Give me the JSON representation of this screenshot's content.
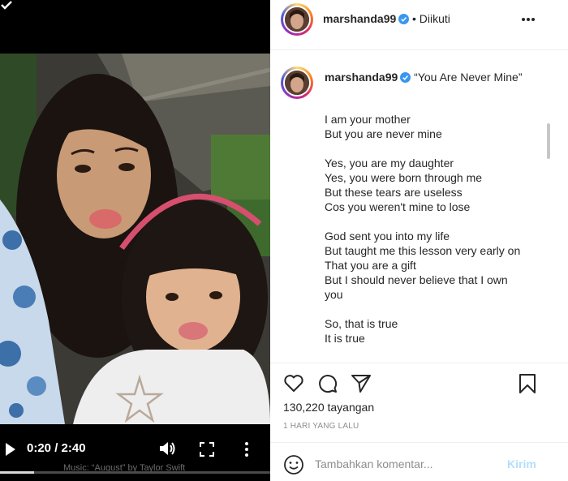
{
  "video": {
    "current_time": "0:20",
    "duration": "2:40",
    "time_separator": " / ",
    "progress_fraction": 0.125,
    "music_credit": "Music: “August” by Taylor Swift",
    "icons": [
      "back-chevron-icon",
      "play-icon",
      "volume-icon",
      "fullscreen-icon",
      "more-vertical-icon"
    ]
  },
  "post": {
    "username": "marshanda99",
    "follow_separator": "•",
    "follow_state": "Diikuti",
    "caption_title": "“You Are Never Mine”",
    "lyrics": [
      [
        "I am your mother",
        "But you are never mine"
      ],
      [
        "Yes, you are my daughter",
        "Yes, you were born through me",
        "But these tears are useless",
        "Cos you weren't mine to lose"
      ],
      [
        "God sent you into my life",
        "But taught me this lesson very early on",
        "That you are a gift",
        "But I should never believe that I own you"
      ],
      [
        "So, that is true",
        "It is true"
      ]
    ],
    "views": "130,220 tayangan",
    "date": "1 HARI YANG LALU"
  },
  "comment": {
    "placeholder": "Tambahkan komentar...",
    "send_label": "Kirim"
  },
  "colors": {
    "verified": "#3897f0",
    "send_disabled": "#b2dffc",
    "muted_text": "#8e8e8e"
  }
}
